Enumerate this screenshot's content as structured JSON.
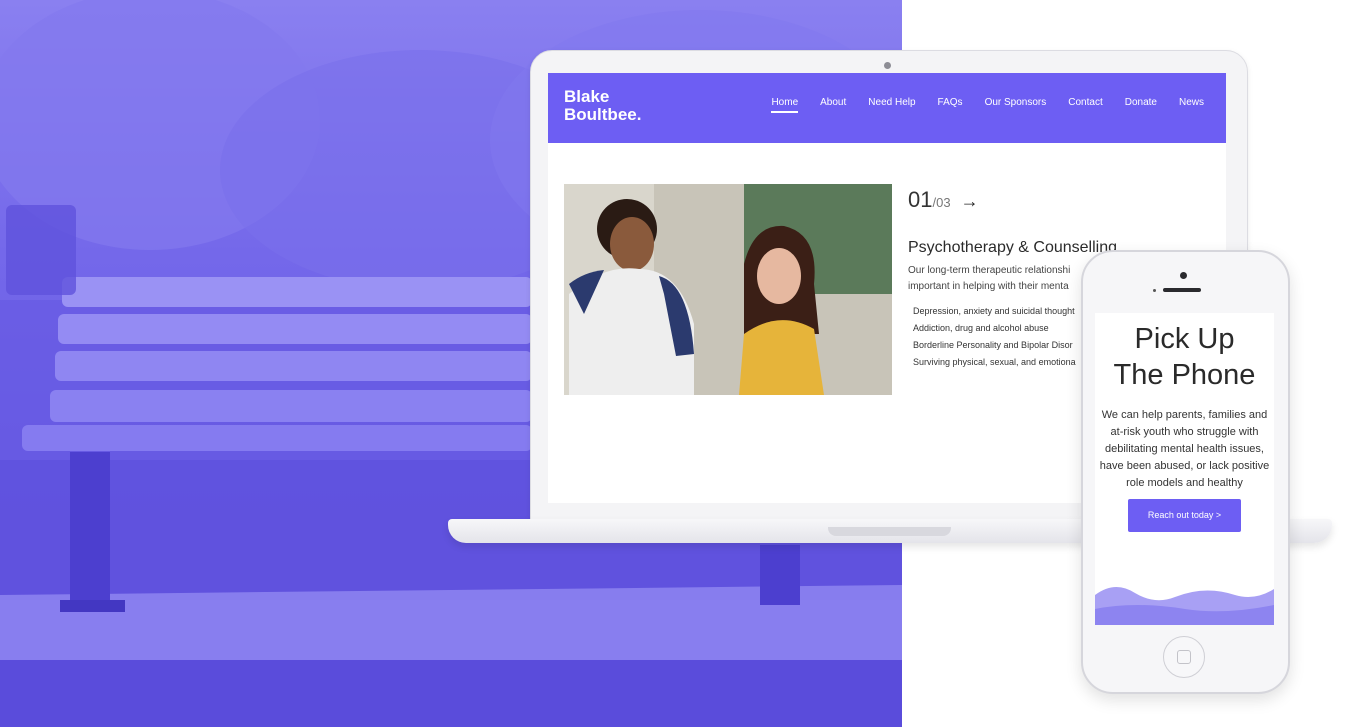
{
  "colors": {
    "brand": "#6d5ef3",
    "overlay": "#6a5ee4"
  },
  "site": {
    "logo": {
      "line1": "Blake",
      "line2": "Boultbee."
    },
    "nav": [
      "Home",
      "About",
      "Need Help",
      "FAQs",
      "Our Sponsors",
      "Contact",
      "Donate",
      "News"
    ],
    "active_nav": "Home"
  },
  "slider": {
    "current": "01",
    "total": "/03",
    "arrow": "→"
  },
  "service": {
    "title": "Psychotherapy & Counselling",
    "desc_line1": "Our long-term therapeutic relationshi",
    "desc_line2": "important in helping with their menta",
    "items": [
      "Depression, anxiety and suicidal thought",
      "Addiction, drug and alcohol abuse",
      "Borderline Personality and Bipolar Disor",
      "Surviving physical, sexual, and emotiona"
    ]
  },
  "mobile": {
    "title_line1": "Pick Up",
    "title_line2": "The Phone",
    "body": "We can help parents, families and at-risk youth who struggle with debilitating mental health issues, have been abused, or lack positive role models and healthy",
    "cta": "Reach out today >"
  }
}
